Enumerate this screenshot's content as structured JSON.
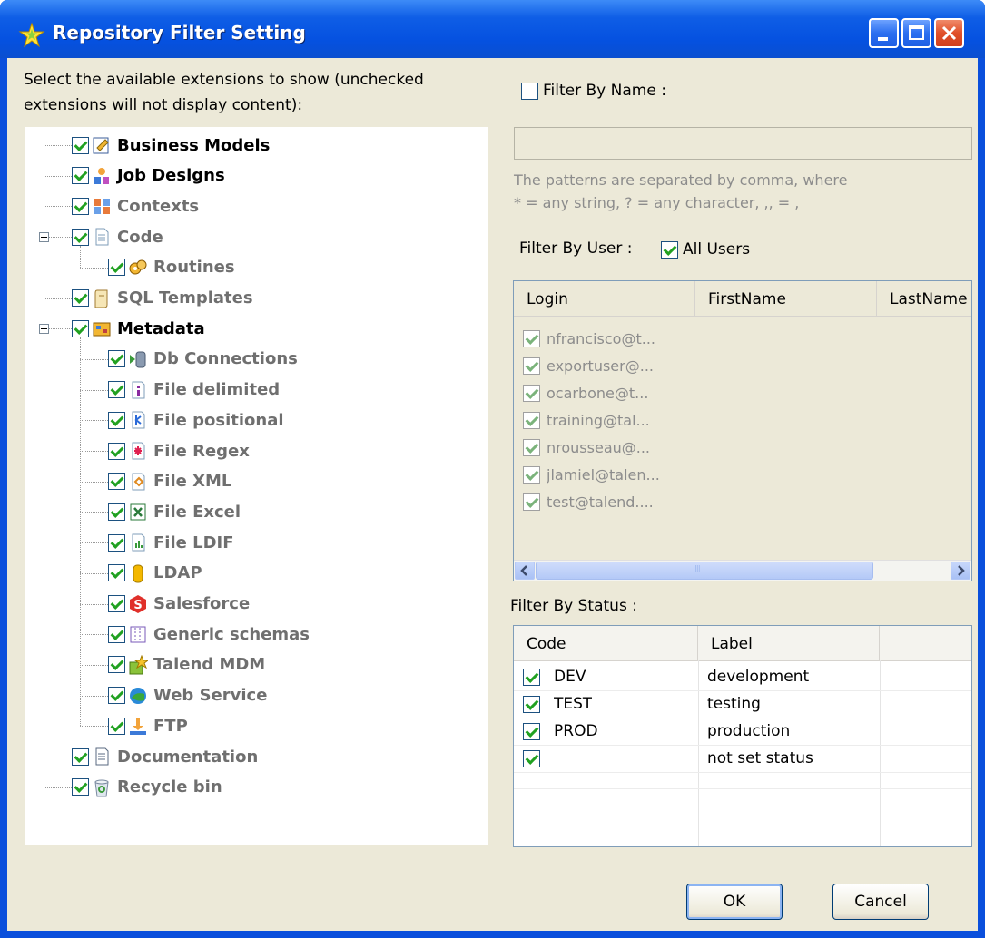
{
  "window": {
    "title": "Repository Filter Setting"
  },
  "left": {
    "instruction": "Select the available extensions to show (unchecked\nextensions will not display content):",
    "instruction_line1": "Select the available extensions to show (unchecked",
    "instruction_line2": "extensions will not display content):",
    "tree": [
      {
        "label": "Business Models",
        "level": 1,
        "bold": true,
        "checked": true,
        "icon": "business-models-icon"
      },
      {
        "label": "Job Designs",
        "level": 1,
        "bold": true,
        "checked": true,
        "icon": "job-designs-icon"
      },
      {
        "label": "Contexts",
        "level": 1,
        "checked": true,
        "icon": "contexts-icon"
      },
      {
        "label": "Code",
        "level": 1,
        "checked": true,
        "expanded": true,
        "icon": "code-icon"
      },
      {
        "label": "Routines",
        "level": 2,
        "checked": true,
        "icon": "routines-icon"
      },
      {
        "label": "SQL Templates",
        "level": 1,
        "checked": true,
        "icon": "sql-templates-icon"
      },
      {
        "label": "Metadata",
        "level": 1,
        "bold": true,
        "checked": true,
        "expanded": true,
        "icon": "metadata-icon"
      },
      {
        "label": "Db Connections",
        "level": 2,
        "checked": true,
        "icon": "db-connections-icon"
      },
      {
        "label": "File delimited",
        "level": 2,
        "checked": true,
        "icon": "file-delimited-icon"
      },
      {
        "label": "File positional",
        "level": 2,
        "checked": true,
        "icon": "file-positional-icon"
      },
      {
        "label": "File Regex",
        "level": 2,
        "checked": true,
        "icon": "file-regex-icon"
      },
      {
        "label": "File XML",
        "level": 2,
        "checked": true,
        "icon": "file-xml-icon"
      },
      {
        "label": "File Excel",
        "level": 2,
        "checked": true,
        "icon": "file-excel-icon"
      },
      {
        "label": "File LDIF",
        "level": 2,
        "checked": true,
        "icon": "file-ldif-icon"
      },
      {
        "label": "LDAP",
        "level": 2,
        "checked": true,
        "icon": "ldap-icon"
      },
      {
        "label": "Salesforce",
        "level": 2,
        "checked": true,
        "icon": "salesforce-icon"
      },
      {
        "label": "Generic schemas",
        "level": 2,
        "checked": true,
        "icon": "generic-schemas-icon"
      },
      {
        "label": "Talend MDM",
        "level": 2,
        "checked": true,
        "icon": "talend-mdm-icon"
      },
      {
        "label": "Web Service",
        "level": 2,
        "checked": true,
        "icon": "web-service-icon"
      },
      {
        "label": "FTP",
        "level": 2,
        "checked": true,
        "icon": "ftp-icon"
      },
      {
        "label": "Documentation",
        "level": 1,
        "checked": true,
        "icon": "documentation-icon"
      },
      {
        "label": "Recycle bin",
        "level": 1,
        "checked": true,
        "icon": "recycle-bin-icon"
      }
    ]
  },
  "right": {
    "filter_by_name": {
      "label": "Filter By Name :",
      "checked": false,
      "value": ""
    },
    "hint_line1": "The patterns are separated by comma, where",
    "hint_line2": "* = any string, ? = any character, ,, = ,",
    "filter_by_user": {
      "label": "Filter By User :",
      "all_users_label": "All Users",
      "all_users_checked": true
    },
    "users_table": {
      "columns": [
        "Login",
        "FirstName",
        "LastName"
      ],
      "rows": [
        {
          "login": "nfrancisco@t...",
          "first": "",
          "last": ""
        },
        {
          "login": "exportuser@...",
          "first": "",
          "last": ""
        },
        {
          "login": "ocarbone@t...",
          "first": "",
          "last": ""
        },
        {
          "login": "training@tal...",
          "first": "",
          "last": ""
        },
        {
          "login": "nrousseau@...",
          "first": "",
          "last": ""
        },
        {
          "login": "jlamiel@talen...",
          "first": "",
          "last": ""
        },
        {
          "login": "test@talend....",
          "first": "",
          "last": ""
        }
      ],
      "scroll_thumb_grip": "IIII"
    },
    "filter_by_status": {
      "label": "Filter By Status :",
      "columns": [
        "Code",
        "Label"
      ],
      "rows": [
        {
          "code": "DEV",
          "label": "development",
          "checked": true
        },
        {
          "code": "TEST",
          "label": "testing",
          "checked": true
        },
        {
          "code": "PROD",
          "label": "production",
          "checked": true
        },
        {
          "code": "",
          "label": "not set status",
          "checked": true
        }
      ]
    }
  },
  "buttons": {
    "ok": "OK",
    "cancel": "Cancel"
  },
  "colors": {
    "titlebar": "#0a4fdc",
    "dialog_bg": "#ece9d8",
    "check": "#21a121"
  }
}
